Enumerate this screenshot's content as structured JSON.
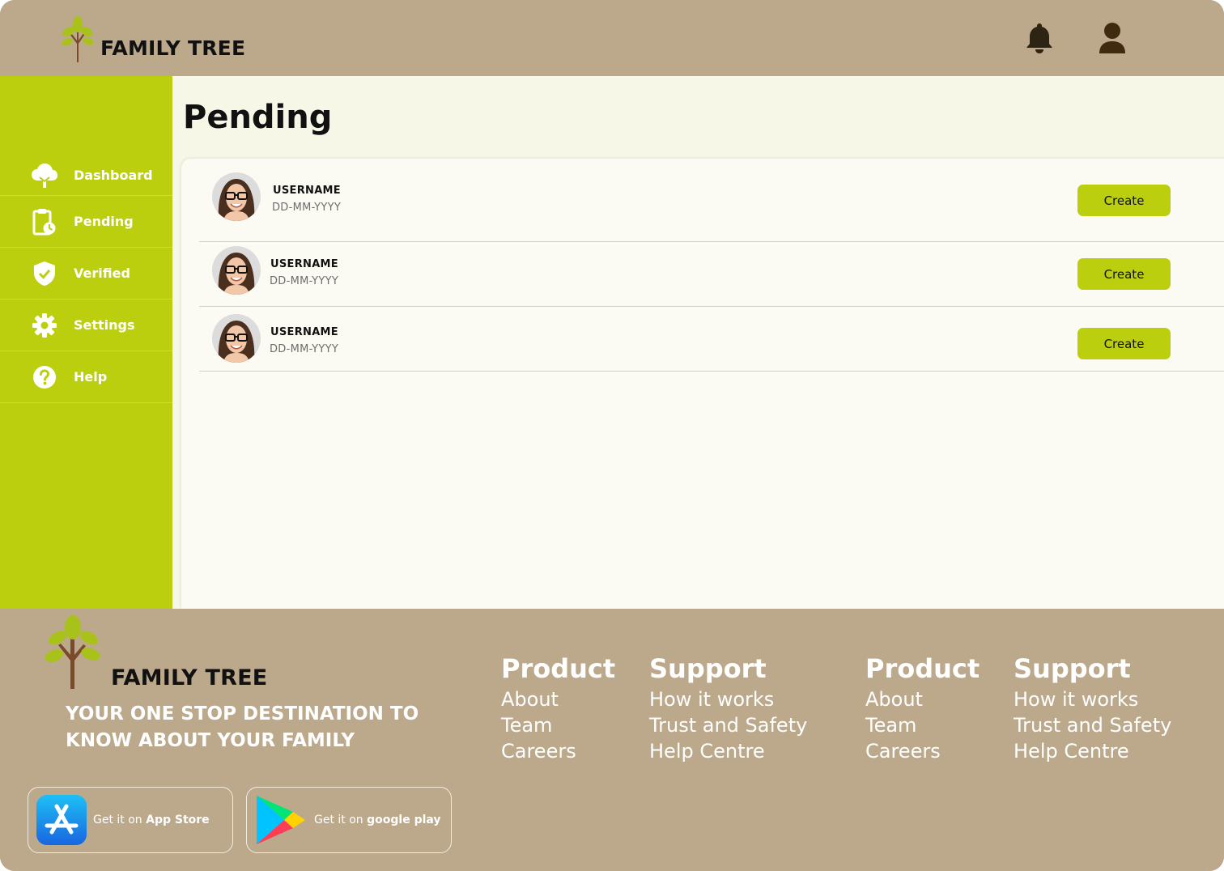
{
  "brand": {
    "name": "FAMILY TREE"
  },
  "header": {
    "notification_icon": "bell-icon",
    "profile_icon": "user-icon"
  },
  "sidebar": {
    "items": [
      {
        "label": "Dashboard",
        "icon": "cloud-tree-icon"
      },
      {
        "label": "Pending",
        "icon": "clipboard-clock-icon"
      },
      {
        "label": "Verified",
        "icon": "shield-check-icon"
      },
      {
        "label": "Settings",
        "icon": "gear-icon"
      },
      {
        "label": "Help",
        "icon": "question-circle-icon"
      }
    ]
  },
  "main": {
    "title": "Pending",
    "entries": [
      {
        "username": "USERNAME",
        "date": "DD-MM-YYYY",
        "action": "Create"
      },
      {
        "username": "USERNAME",
        "date": "DD-MM-YYYY",
        "action": "Create"
      },
      {
        "username": "USERNAME",
        "date": "DD-MM-YYYY",
        "action": "Create"
      }
    ]
  },
  "footer": {
    "brand": "FAMILY TREE",
    "tagline": "YOUR ONE STOP DESTINATION TO KNOW ABOUT YOUR FAMILY",
    "columns": [
      {
        "title": "Product",
        "links": [
          "About",
          "Team",
          "Careers"
        ]
      },
      {
        "title": "Support",
        "links": [
          "How it works",
          "Trust and Safety",
          "Help Centre"
        ]
      },
      {
        "title": "Product",
        "links": [
          "About",
          "Team",
          "Careers"
        ]
      },
      {
        "title": "Support",
        "links": [
          "How it works",
          "Trust and Safety",
          "Help Centre"
        ]
      }
    ],
    "app_store": {
      "prefix": "Get it on ",
      "name": "App Store"
    },
    "google_play": {
      "prefix": "Get it on ",
      "name": "google play"
    }
  },
  "colors": {
    "header_bg": "#bca98c",
    "sidebar_bg": "#bccf0f",
    "accent": "#bccf0f",
    "main_bg": "#f7f7e8",
    "text_dark": "#111111"
  }
}
